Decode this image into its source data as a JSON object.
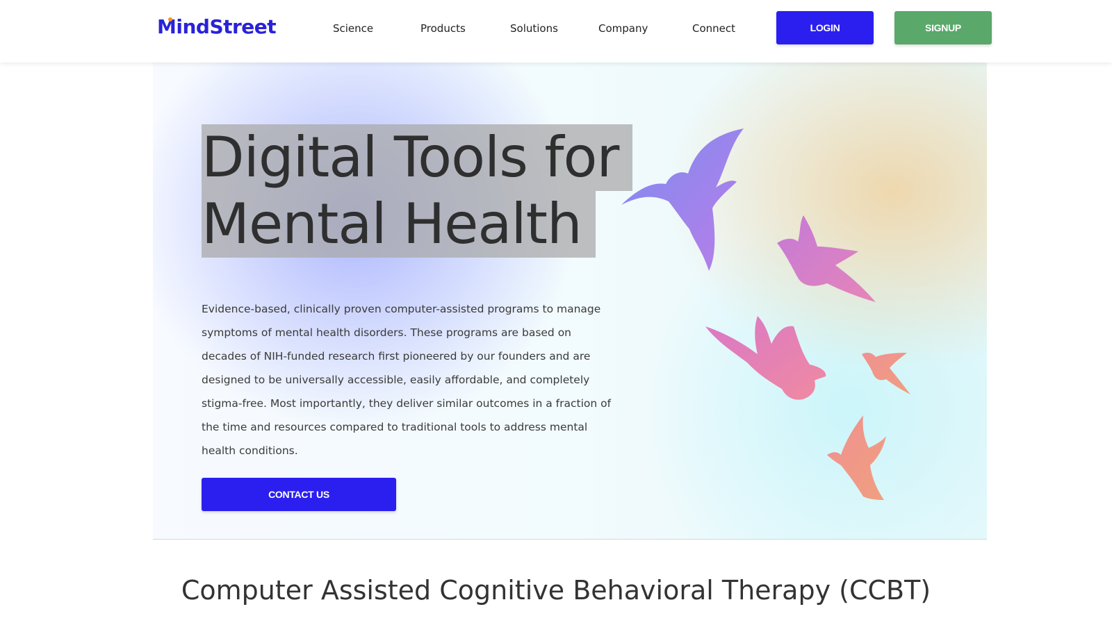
{
  "header": {
    "logo": "MindStreet",
    "nav": [
      "Science",
      "Products",
      "Solutions",
      "Company",
      "Connect"
    ],
    "login_label": "LOGIN",
    "signup_label": "SIGNUP"
  },
  "hero": {
    "title_line1": "Digital Tools for",
    "title_line2": "Mental Health",
    "description": "Evidence-based, clinically proven computer-assisted programs to manage symptoms of mental health disorders. These programs are based on decades of NIH-funded research first pioneered by our founders and are designed to be universally accessible, easily affordable, and completely stigma-free. Most importantly, they deliver similar outcomes in a fraction of the time and resources compared to traditional tools to address mental health conditions.",
    "cta_label": "CONTACT US"
  },
  "section": {
    "title": "Computer Assisted Cognitive Behavioral Therapy (CCBT)"
  },
  "colors": {
    "brand_blue": "#2b1ff0",
    "signup_green": "#5aa86a",
    "logo_dot": "#f39422"
  },
  "icons": [
    "hummingbird-icon",
    "bird-icon",
    "dove-icon",
    "small-bird-icon",
    "rising-bird-icon"
  ]
}
